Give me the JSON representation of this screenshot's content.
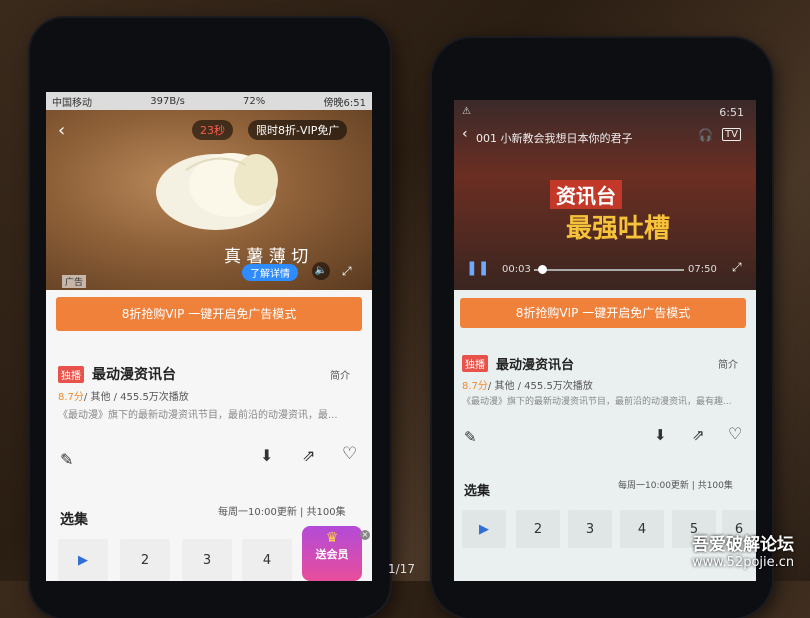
{
  "left_phone": {
    "status": {
      "carrier": "中国移动",
      "speed": "397B/s",
      "battery": "72%",
      "time": "傍晚6:51"
    },
    "ad": {
      "countdown": "23秒",
      "vip_button": "限时8折-VIP免广",
      "caption": "真 薯 薄 切",
      "detail_button": "了解详情",
      "ad_label": "广告"
    },
    "vip_bar": "8折抢购VIP 一键开启免广告模式",
    "show": {
      "tag": "独播",
      "title": "最动漫资讯台",
      "intro": "简介",
      "score": "8.7分",
      "meta": " / 其他 / 455.5万次播放",
      "desc": "《最动漫》旗下的最新动漫资讯节目，最前沿的动漫资讯，最..."
    },
    "episodes": {
      "label": "选集",
      "schedule": "每周一10:00更新 | 共100集",
      "items": [
        "2",
        "3",
        "4"
      ]
    },
    "promo": "送会员"
  },
  "right_phone": {
    "video": {
      "title": "001 小新教会我想日本你的君子",
      "overlay_text_1": "资讯台",
      "overlay_text_2": "最强吐槽",
      "time_current": "00:03",
      "time_total": "07:50"
    },
    "status": {
      "time": "6:51"
    },
    "vip_bar": "8折抢购VIP 一键开启免广告模式",
    "show": {
      "tag": "独播",
      "title": "最动漫资讯台",
      "intro": "简介",
      "score": "8.7分",
      "meta": " / 其他 / 455.5万次播放",
      "desc": "《最动漫》旗下的最新动漫资讯节目，最前沿的动漫资讯，最有趣..."
    },
    "episodes": {
      "label": "选集",
      "schedule": "每周一10:00更新 | 共100集",
      "items": [
        "2",
        "3",
        "4",
        "5",
        "6"
      ]
    }
  },
  "page_counter": "1/17",
  "watermark": {
    "line1": "吾爱破解论坛",
    "line2": "www.52pojie.cn"
  }
}
